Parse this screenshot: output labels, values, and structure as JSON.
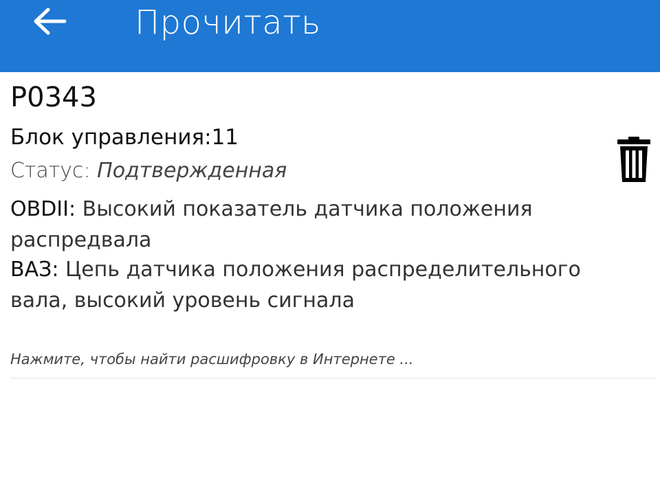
{
  "app_bar": {
    "title": "Прочитать",
    "back_icon": "arrow-left-icon",
    "background": "#1e78d4"
  },
  "dtc": {
    "code": "P0343",
    "ecu_label": "Блок управления:",
    "ecu_value": "11",
    "status_label": "Статус: ",
    "status_value": "Подтвержденная",
    "obd_label": "OBDII:",
    "obd_text": " Высокий показатель датчика положения распредвала",
    "vaz_label": "ВАЗ:",
    "vaz_text": " Цепь датчика положения распределительного вала, высокий уровень сигнала",
    "hint": "Нажмите, чтобы найти расшифровку в Интернете ...",
    "delete_icon": "trash-icon"
  }
}
